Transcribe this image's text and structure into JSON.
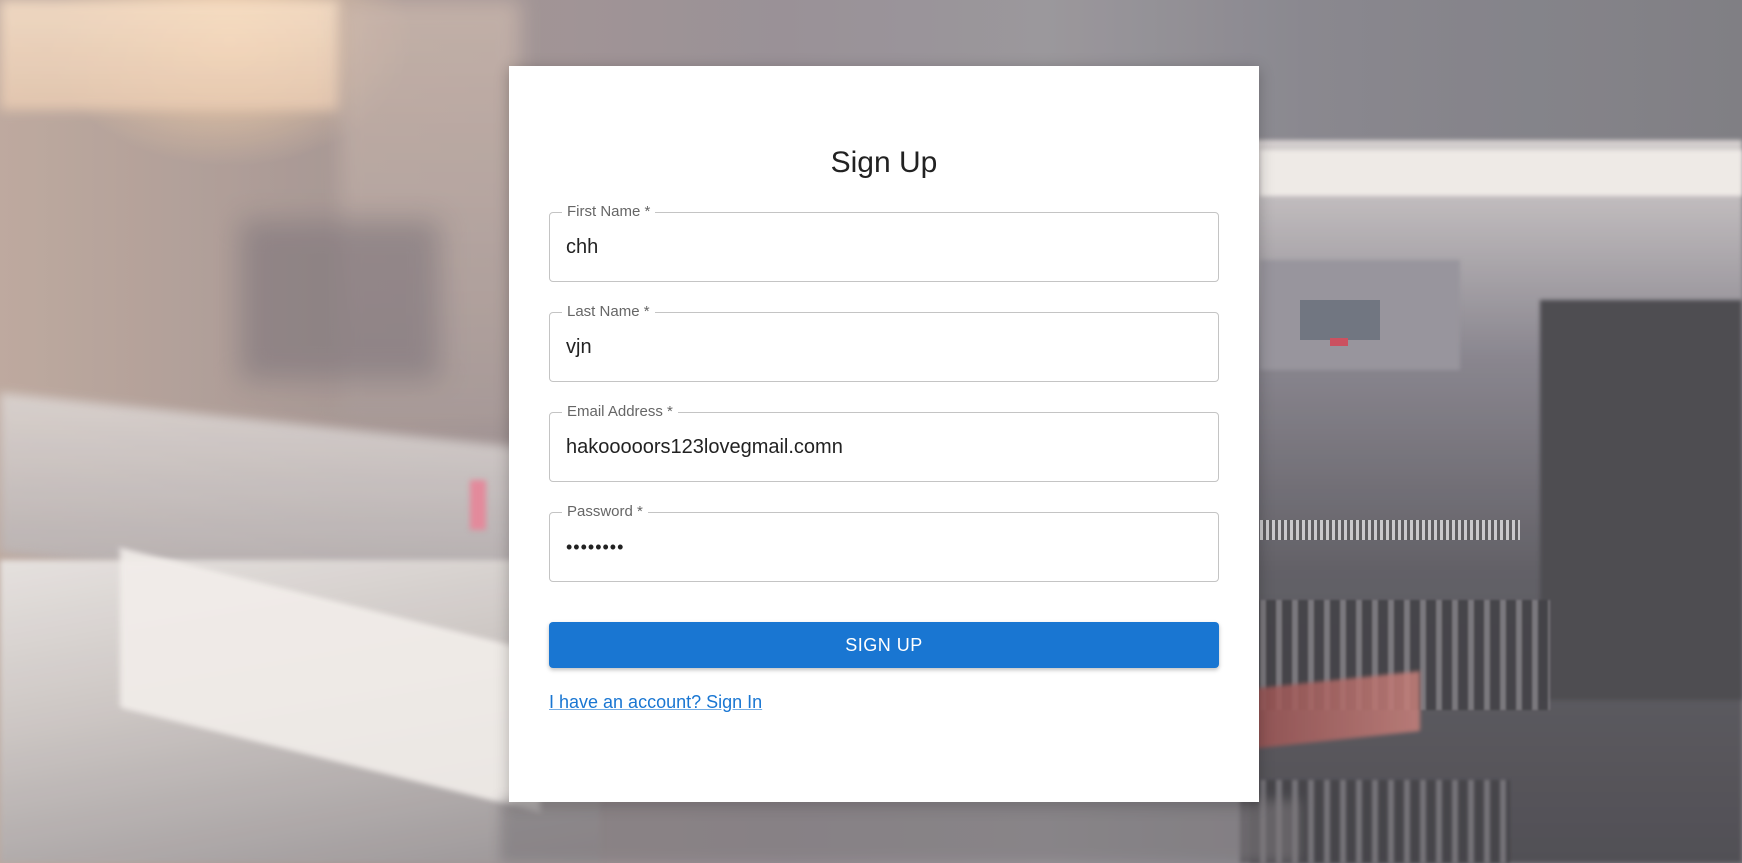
{
  "form": {
    "title": "Sign Up",
    "fields": [
      {
        "label": "First Name *",
        "value": "chh",
        "placeholder": ""
      },
      {
        "label": "Last Name *",
        "value": "vjn",
        "placeholder": ""
      },
      {
        "label": "Email Address *",
        "value": "hakooooors123lovegmail.comn",
        "placeholder": ""
      },
      {
        "label": "Password *",
        "value": "fakepass",
        "placeholder": ""
      }
    ],
    "submit_label": "SIGN UP",
    "signin_link": "I have an account? Sign In"
  },
  "colors": {
    "primary": "#1976d2",
    "card_background": "#ffffff",
    "field_border": "#c4c4c4"
  }
}
